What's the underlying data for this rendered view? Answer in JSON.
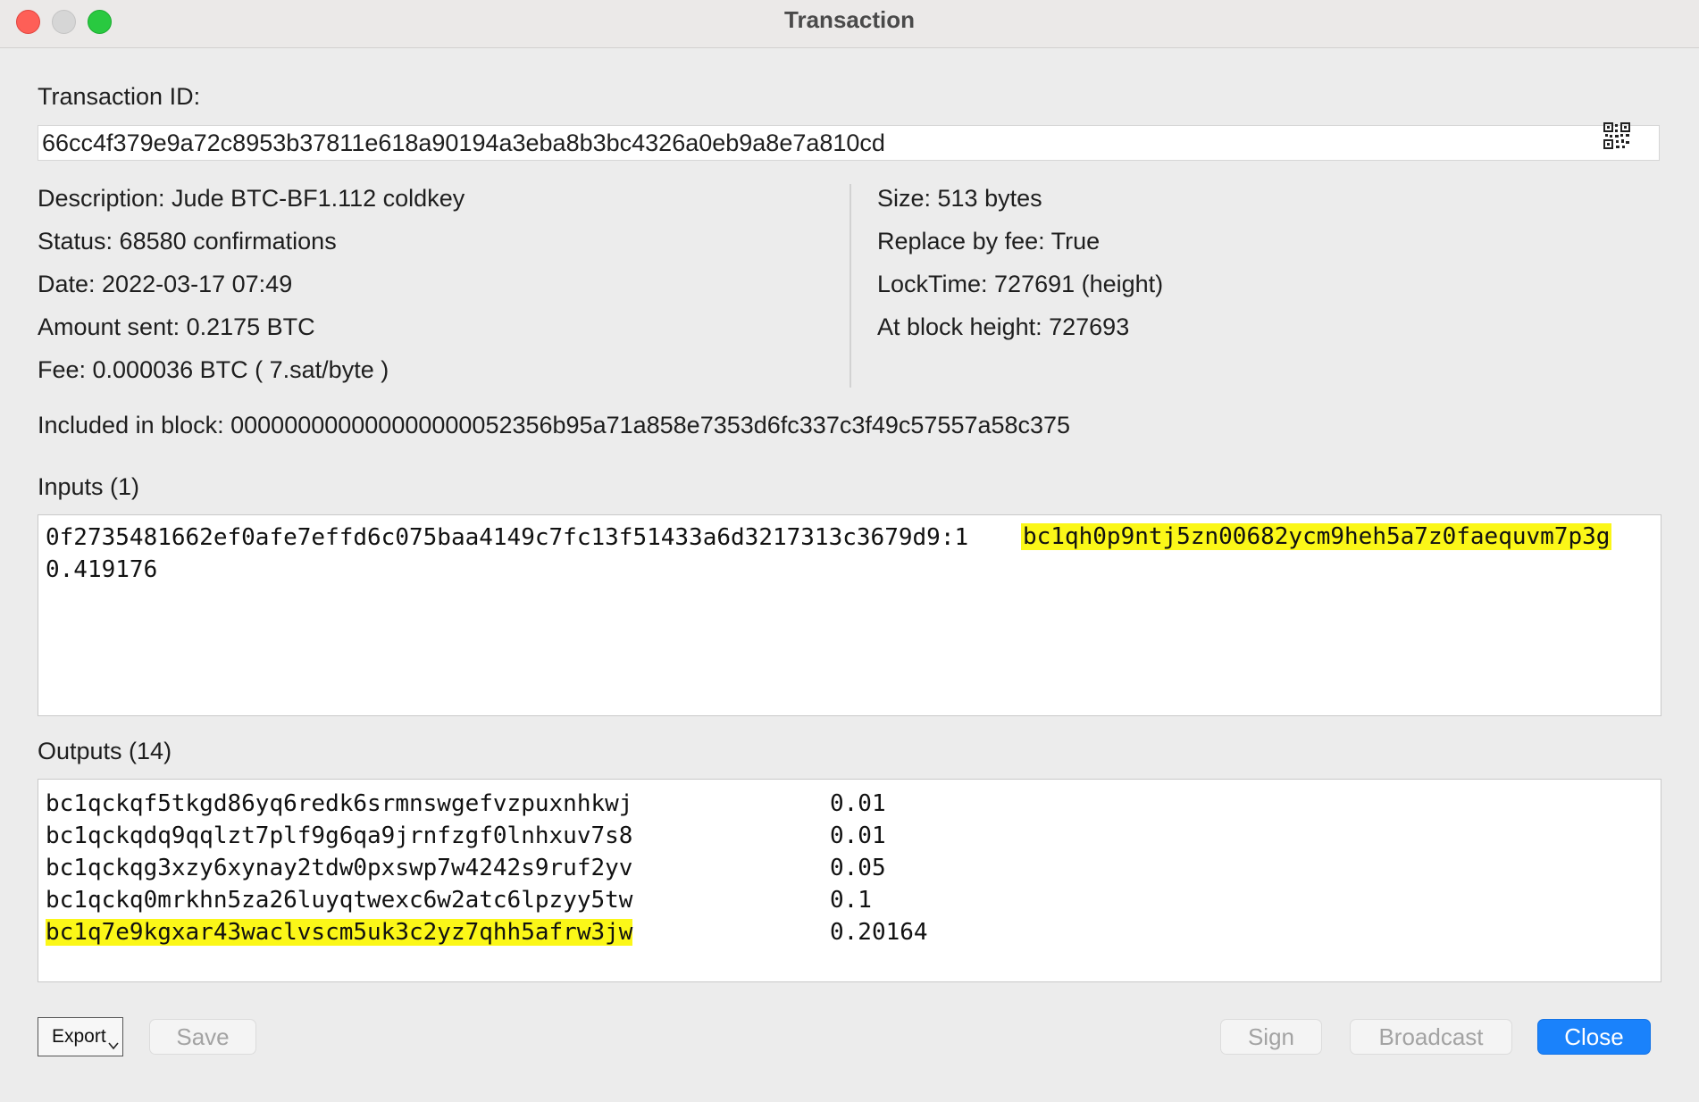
{
  "window": {
    "title": "Transaction"
  },
  "txid": {
    "label": "Transaction ID:",
    "value": "66cc4f379e9a72c8953b37811e618a90194a3eba8b3bc4326a0eb9a8e7a810cd"
  },
  "details_left": {
    "description": "Description: Jude BTC-BF1.112 coldkey",
    "status": "Status: 68580 confirmations",
    "date": "Date: 2022-03-17 07:49",
    "amount_sent": "Amount sent: 0.2175 BTC",
    "fee": "Fee: 0.000036 BTC  ( 7.sat/byte )"
  },
  "details_right": {
    "size": "Size: 513 bytes",
    "rbf": "Replace by fee: True",
    "locktime": "LockTime: 727691 (height)",
    "block_height": "At block height: 727693"
  },
  "included_block": "Included in block: 000000000000000000052356b95a71a858e7353d6fc337c3f49c57557a58c375",
  "inputs": {
    "heading": "Inputs (1)",
    "items": [
      {
        "prevout": "0f2735481662ef0afe7effd6c075baa4149c7fc13f51433a6d3217313c3679d9:1",
        "address": "bc1qh0p9ntj5zn00682ycm9heh5a7z0faequvm7p3g",
        "amount": "0.419176"
      }
    ]
  },
  "outputs": {
    "heading": "Outputs (14)",
    "rows": [
      {
        "address": "bc1qckqf5tkgd86yq6redk6srmnswgefvzpuxnhkwj",
        "amount": "0.01"
      },
      {
        "address": "bc1qckqdq9qqlzt7plf9g6qa9jrnfzgf0lnhxuv7s8",
        "amount": "0.01"
      },
      {
        "address": "bc1qckqg3xzy6xynay2tdw0pxswp7w4242s9ruf2yv",
        "amount": "0.05"
      },
      {
        "address": "bc1qckq0mrkhn5za26luyqtwexc6w2atc6lpzyy5tw",
        "amount": "0.1"
      },
      {
        "address": "bc1q7e9kgxar43waclvscm5uk3c2yz7qhh5afrw3jw",
        "amount": "0.20164"
      }
    ]
  },
  "buttons": {
    "export": "Export",
    "save": "Save",
    "sign": "Sign",
    "broadcast": "Broadcast",
    "close": "Close"
  },
  "icons": {
    "qr": "qr-code-icon",
    "dropdown": "chevron-down-icon"
  },
  "colors": {
    "highlight": "#fbf718",
    "primary_button": "#1a82fb",
    "close_light": "#fe5f57",
    "zoom_light": "#29c940"
  }
}
